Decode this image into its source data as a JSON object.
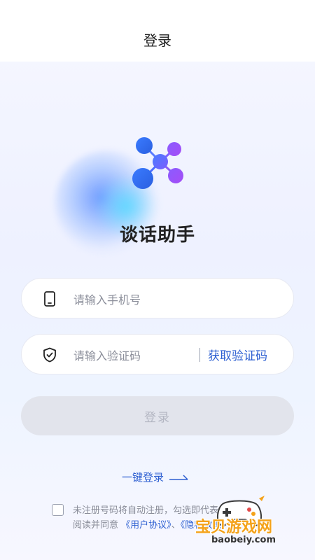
{
  "header": {
    "title": "登录"
  },
  "app": {
    "name": "谈话助手",
    "accent": "#2d5fd1"
  },
  "form": {
    "phone_placeholder": "请输入手机号",
    "phone_value": "",
    "code_placeholder": "请输入验证码",
    "code_value": "",
    "get_code_label": "获取验证码",
    "login_label": "登录"
  },
  "quick_login": {
    "label": "一键登录"
  },
  "agreement": {
    "checked": false,
    "line1": "未注册号码将自动注册，勾选即代表您已",
    "line2_prefix": "阅读并同意",
    "user_agreement": "《用户协议》",
    "separator": "、",
    "privacy_policy": "《隐私政策》"
  },
  "watermark": {
    "main": "宝贝游戏网",
    "sub": "baobeiy.com"
  },
  "icons": {
    "phone": "phone-icon",
    "shield": "shield-check-icon",
    "arrow": "arrow-right-icon",
    "logo": "app-logo-icon"
  }
}
